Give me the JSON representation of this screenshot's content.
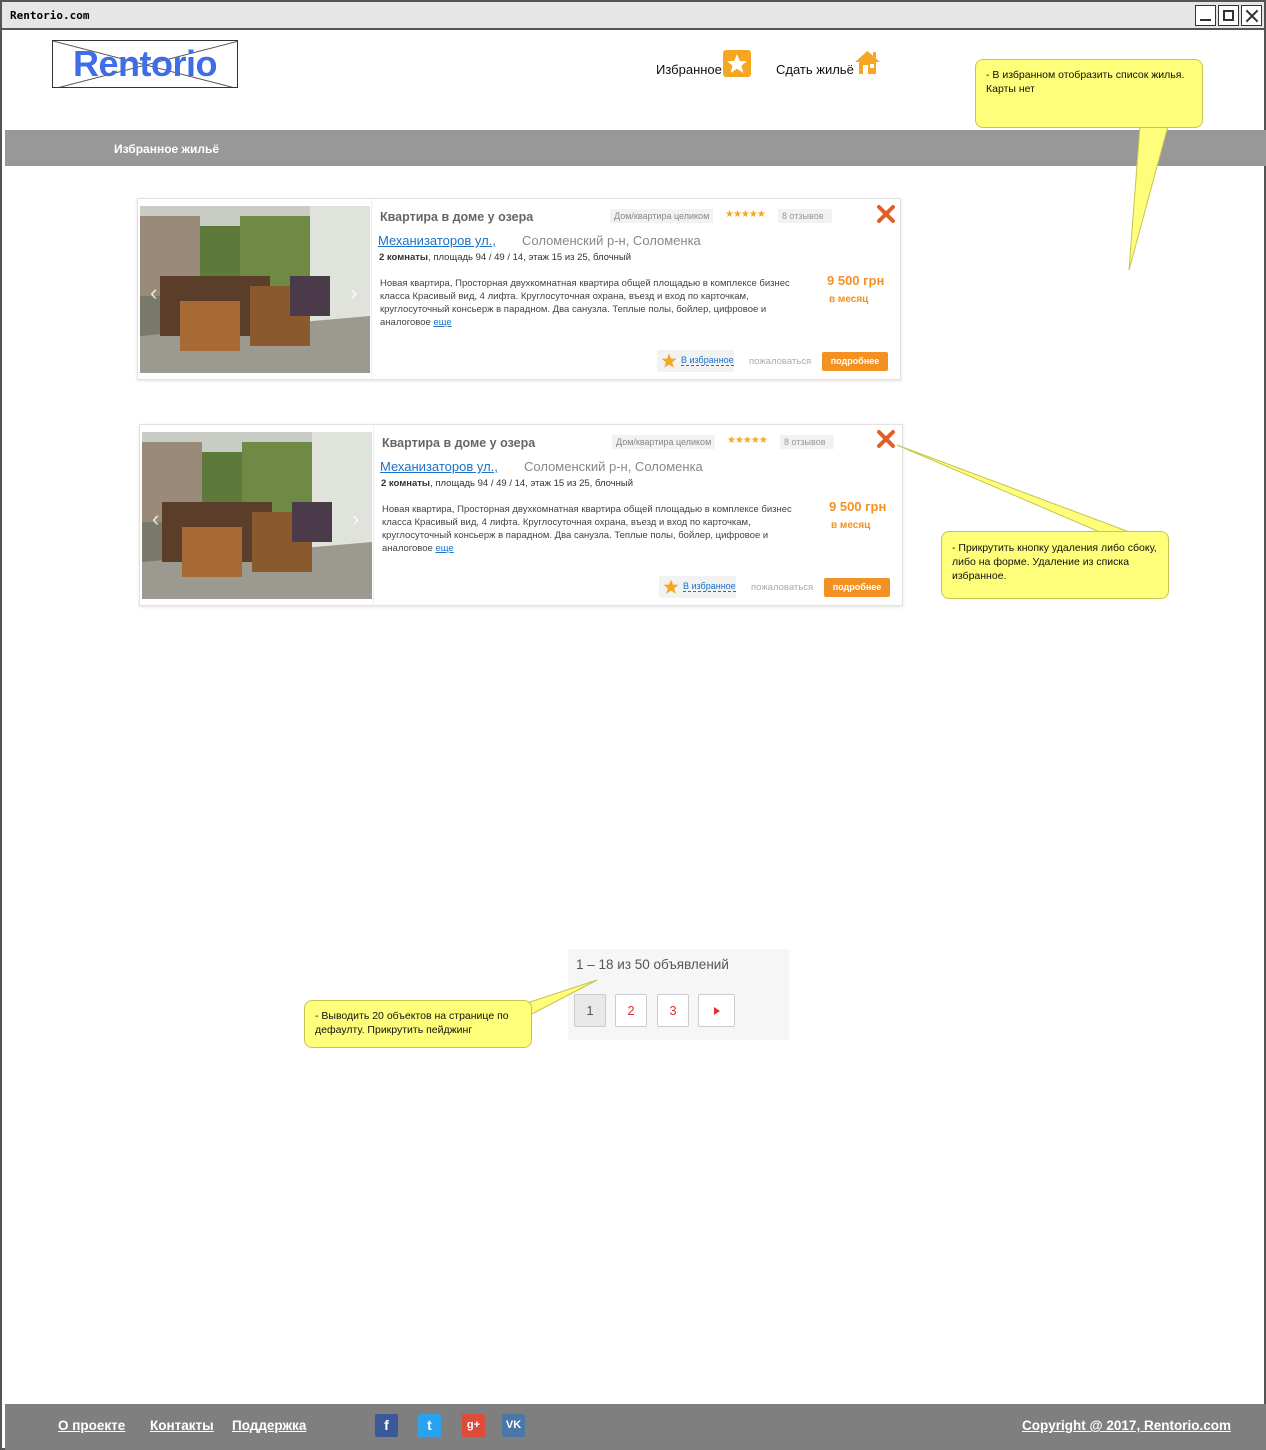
{
  "window": {
    "title": "Rentorio.com"
  },
  "header": {
    "logo_text": "Rentorio",
    "favorites_label": "Избранное",
    "rent_out_label": "Сдать жильё"
  },
  "nav": {
    "title": "Избранное жильё"
  },
  "notes": {
    "favorites_list": "- В избранном отобразить список жилья. Карты нет",
    "delete_button": "- Прикрутить кнопку удаления либо сбоку, либо на форме. Удаление из списка избранное.",
    "paging": "- Выводить 20 объектов на странице по дефаулту. Прикрутить пейджинг"
  },
  "listings": [
    {
      "title": "Квартира в доме у озера",
      "type": "Дом/квартира целиком",
      "stars": "★★★★★",
      "reviews": "8 отзывов",
      "street": "Механизаторов ул.,",
      "district": "Соломенский р-н, Соломенка",
      "rooms_bold": "2 комнаты",
      "rooms_rest": ", площадь 94 / 49 / 14, этаж 15 из 25, блочный",
      "description": "Новая квартира, Просторная двухкомнатная квартира общей площадью в комплексе бизнес класса Красивый вид, 4 лифта. Круглосуточная охрана, въезд и вход по карточкам, круглосуточный консьерж в парадном. Два санузла. Теплые полы, бойлер, цифровое и аналоговое ",
      "more": "еще",
      "price": "9 500 грн",
      "period": "в месяц",
      "favorite_label": "В избранное",
      "complain_label": "пожаловаться",
      "details_label": "подробнее"
    },
    {
      "title": "Квартира в доме у озера",
      "type": "Дом/квартира целиком",
      "stars": "★★★★★",
      "reviews": "8 отзывов",
      "street": "Механизаторов ул.,",
      "district": "Соломенский р-н, Соломенка",
      "rooms_bold": "2 комнаты",
      "rooms_rest": ", площадь 94 / 49 / 14, этаж 15 из 25, блочный",
      "description": "Новая квартира, Просторная двухкомнатная квартира общей площадью в комплексе бизнес класса Красивый вид, 4 лифта. Круглосуточная охрана, въезд и вход по карточкам, круглосуточный консьерж в парадном. Два санузла. Теплые полы, бойлер, цифровое и аналоговое ",
      "more": "еще",
      "price": "9 500 грн",
      "period": "в месяц",
      "favorite_label": "В избранное",
      "complain_label": "пожаловаться",
      "details_label": "подробнее"
    }
  ],
  "pagination": {
    "info": "1 – 18 из 50 объявлений",
    "pages": [
      "1",
      "2",
      "3"
    ],
    "current": "1"
  },
  "footer": {
    "links": [
      "О проекте",
      "Контакты",
      "Поддержка"
    ],
    "social": [
      "f",
      "t",
      "g+",
      "VK"
    ],
    "copyright": "Copyright @ 2017, Rentorio.com"
  },
  "colors": {
    "accent_orange": "#f39122",
    "link_blue": "#1a73c8",
    "note_yellow": "#fefe7a",
    "bar_gray": "#989898",
    "footer_gray": "#7f7f7f"
  }
}
